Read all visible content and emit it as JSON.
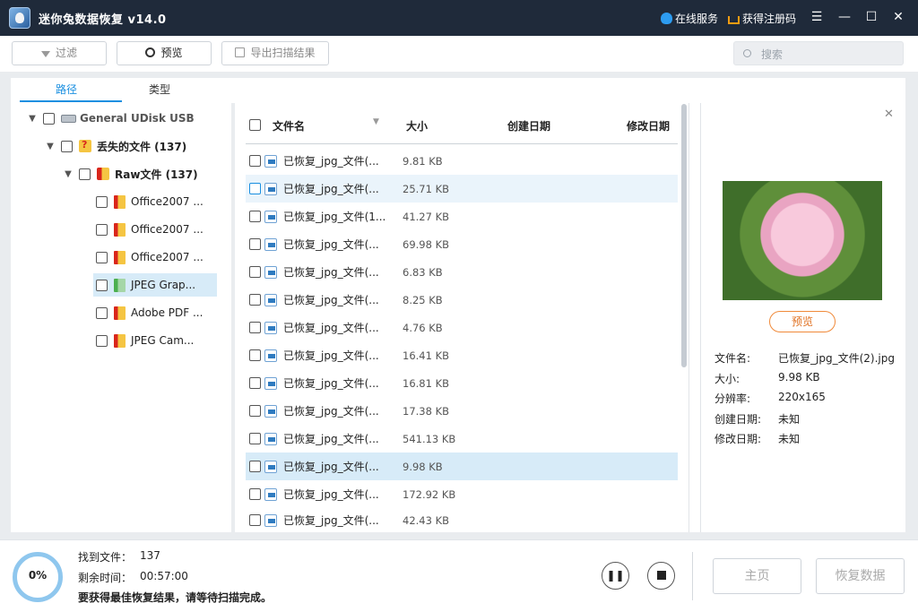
{
  "app": {
    "title": "迷你兔数据恢复 v14.0"
  },
  "titlebar": {
    "online_service": "在线服务",
    "get_code": "获得注册码",
    "menu_icon": "☰",
    "min_icon": "—",
    "max_icon": "☐",
    "close_icon": "✕"
  },
  "toolbar": {
    "filter_label": "过滤",
    "preview_label": "预览",
    "export_label": "导出扫描结果",
    "search_placeholder": "搜索"
  },
  "tabs": [
    {
      "label": "路径"
    },
    {
      "label": "类型"
    }
  ],
  "tree": {
    "disk": "General UDisk USB",
    "lost": "丢失的文件 (137)",
    "raw": "Raw文件 (137)",
    "types": [
      "Office2007 ...",
      "Office2007 ...",
      "Office2007 ...",
      "JPEG Grap...",
      "Adobe PDF ...",
      "JPEG Cam..."
    ]
  },
  "columns": {
    "name": "文件名",
    "size": "大小",
    "created": "创建日期",
    "modified": "修改日期"
  },
  "files": [
    {
      "name": "已恢复_jpg_文件(...",
      "size": "9.81 KB"
    },
    {
      "name": "已恢复_jpg_文件(...",
      "size": "25.71 KB"
    },
    {
      "name": "已恢复_jpg_文件(1...",
      "size": "41.27 KB"
    },
    {
      "name": "已恢复_jpg_文件(...",
      "size": "69.98 KB"
    },
    {
      "name": "已恢复_jpg_文件(...",
      "size": "6.83 KB"
    },
    {
      "name": "已恢复_jpg_文件(...",
      "size": "8.25 KB"
    },
    {
      "name": "已恢复_jpg_文件(...",
      "size": "4.76 KB"
    },
    {
      "name": "已恢复_jpg_文件(...",
      "size": "16.41 KB"
    },
    {
      "name": "已恢复_jpg_文件(...",
      "size": "16.81 KB"
    },
    {
      "name": "已恢复_jpg_文件(...",
      "size": "17.38 KB"
    },
    {
      "name": "已恢复_jpg_文件(...",
      "size": "541.13 KB"
    },
    {
      "name": "已恢复_jpg_文件(...",
      "size": "9.98 KB"
    },
    {
      "name": "已恢复_jpg_文件(...",
      "size": "172.92 KB"
    },
    {
      "name": "已恢复_jpg_文件(...",
      "size": "42.43 KB"
    }
  ],
  "details": {
    "preview_button": "预览",
    "filename_label": "文件名:",
    "filename": "已恢复_jpg_文件(2).jpg",
    "size_label": "大小:",
    "size": "9.98 KB",
    "resolution_label": "分辨率:",
    "resolution": "220x165",
    "created_label": "创建日期:",
    "created": "未知",
    "modified_label": "修改日期:",
    "modified": "未知"
  },
  "status": {
    "progress_text": "0%",
    "progress": 0,
    "found_label": "找到文件：",
    "found_value": "137",
    "remain_label": "剩余时间：",
    "remain_value": "00:57:00",
    "note": "要获得最佳恢复结果，请等待扫描完成。",
    "home_button": "主页",
    "recover_button": "恢复数据"
  }
}
